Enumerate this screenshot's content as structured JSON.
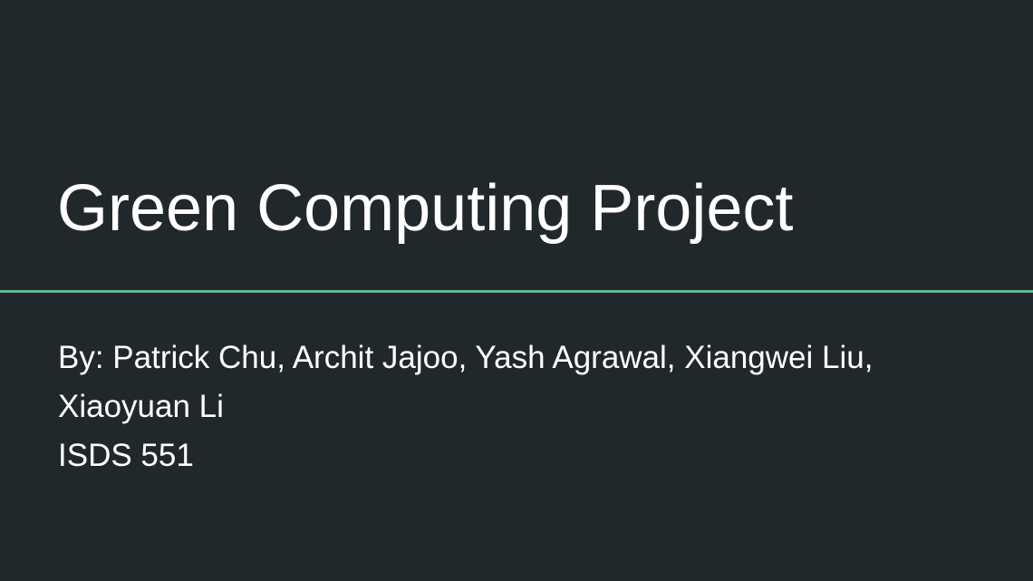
{
  "slide": {
    "title": "Green Computing Project",
    "subtitle_lines": [
      "By: Patrick Chu, Archit Jajoo, Yash Agrawal, Xiangwei Liu,",
      "Xiaoyuan Li",
      "ISDS 551"
    ]
  },
  "colors": {
    "background": "#21282b",
    "accent_line": "#5cc08e",
    "text": "#ffffff"
  }
}
